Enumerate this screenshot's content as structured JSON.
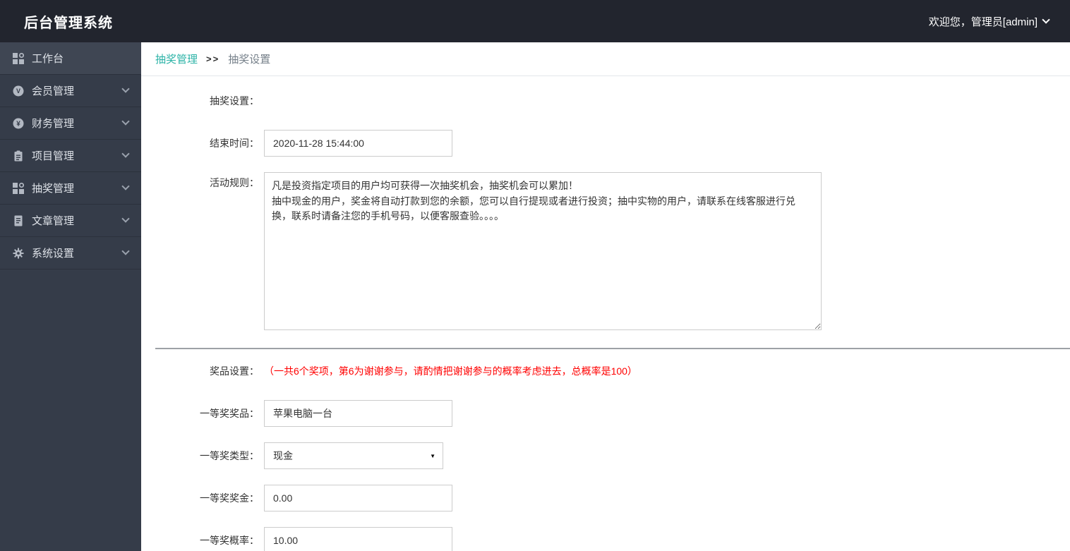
{
  "app": {
    "title": "后台管理系统",
    "welcome": "欢迎您，管理员[admin]"
  },
  "sidebar": {
    "items": [
      {
        "label": "工作台",
        "icon": "grid-icon",
        "active": true
      },
      {
        "label": "会员管理",
        "icon": "member-circle-icon"
      },
      {
        "label": "财务管理",
        "icon": "finance-circle-icon"
      },
      {
        "label": "项目管理",
        "icon": "clipboard-icon"
      },
      {
        "label": "抽奖管理",
        "icon": "grid-icon"
      },
      {
        "label": "文章管理",
        "icon": "document-icon"
      },
      {
        "label": "系统设置",
        "icon": "gear-icon"
      }
    ]
  },
  "breadcrumb": {
    "parent": "抽奖管理",
    "separator": ">>",
    "current": "抽奖设置"
  },
  "form": {
    "section_title": "抽奖设置：",
    "end_time": {
      "label": "结束时间：",
      "value": "2020-11-28 15:44:00"
    },
    "rules": {
      "label": "活动规则：",
      "value": "凡是投资指定项目的用户均可获得一次抽奖机会，抽奖机会可以累加！\n抽中现金的用户，奖金将自动打款到您的余额，您可以自行提现或者进行投资；抽中实物的用户，请联系在线客服进行兑换，联系时请备注您的手机号码，以便客服查验。。。。"
    },
    "prize_section": {
      "label": "奖品设置：",
      "note": "（一共6个奖项，第6为谢谢参与，请酌情把谢谢参与的概率考虑进去，总概率是100）"
    },
    "first_prize_item": {
      "label": "一等奖奖品：",
      "value": "苹果电脑一台"
    },
    "first_prize_type": {
      "label": "一等奖类型：",
      "value": "现金"
    },
    "first_prize_amount": {
      "label": "一等奖奖金：",
      "value": "0.00"
    },
    "first_prize_rate": {
      "label": "一等奖概率：",
      "value": "10.00"
    }
  },
  "icons": {
    "select_arrow": "▼"
  },
  "colors": {
    "accent": "#2cb3a7",
    "note_red": "#ff0000",
    "topbar_bg": "#22252e",
    "sidebar_bg": "#353c49"
  }
}
